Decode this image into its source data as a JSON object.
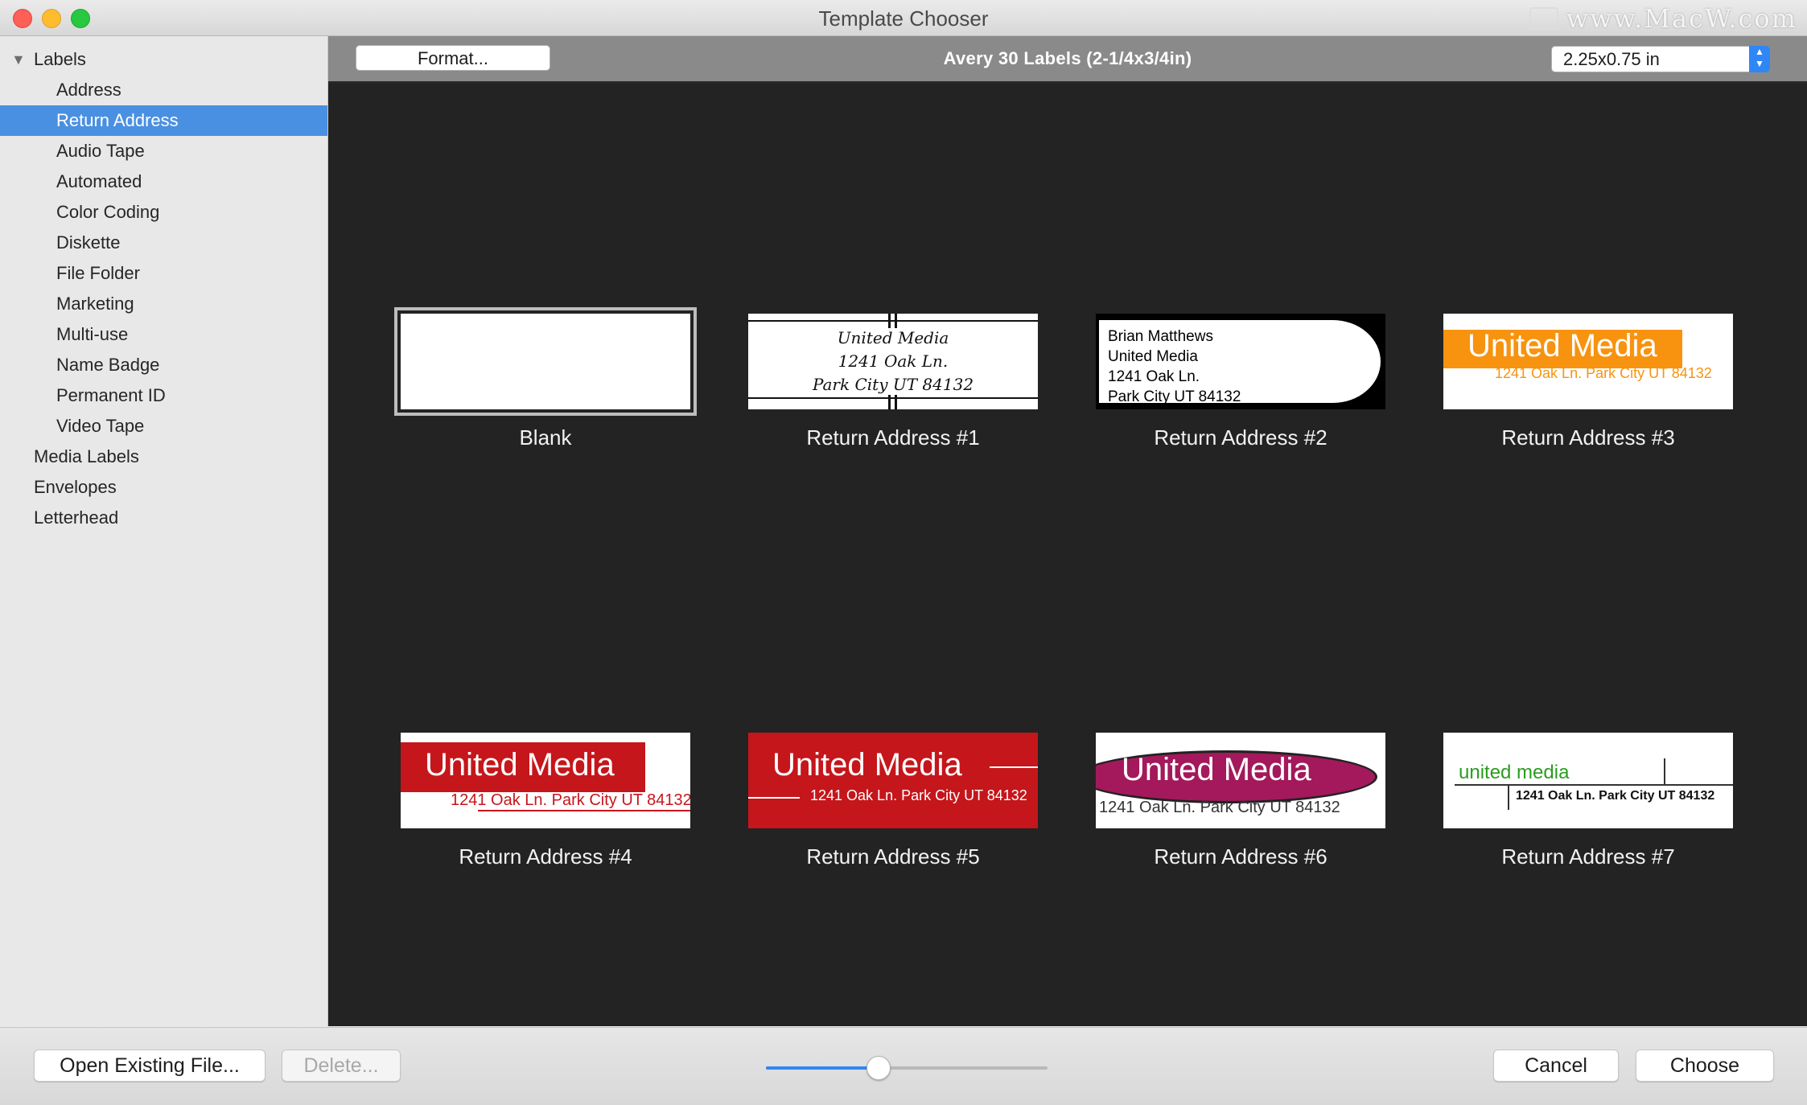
{
  "window": {
    "title": "Template Chooser",
    "watermark": "www.MacW.com"
  },
  "sidebar": {
    "items": [
      {
        "label": "Labels",
        "level": 0,
        "expanded": true
      },
      {
        "label": "Address",
        "level": 1
      },
      {
        "label": "Return Address",
        "level": 1,
        "selected": true
      },
      {
        "label": "Audio Tape",
        "level": 1
      },
      {
        "label": "Automated",
        "level": 1
      },
      {
        "label": "Color Coding",
        "level": 1
      },
      {
        "label": "Diskette",
        "level": 1
      },
      {
        "label": "File Folder",
        "level": 1
      },
      {
        "label": "Marketing",
        "level": 1
      },
      {
        "label": "Multi-use",
        "level": 1
      },
      {
        "label": "Name Badge",
        "level": 1
      },
      {
        "label": "Permanent ID",
        "level": 1
      },
      {
        "label": "Video Tape",
        "level": 1
      },
      {
        "label": "Media Labels",
        "level": 0
      },
      {
        "label": "Envelopes",
        "level": 0
      },
      {
        "label": "Letterhead",
        "level": 0
      }
    ],
    "selected_color": "#4a90e2"
  },
  "toolbar": {
    "format_label": "Format...",
    "title": "Avery 30 Labels (2-1/4x3/4in)",
    "size_value": "2.25x0.75 in"
  },
  "templates": [
    {
      "label": "Blank",
      "selected": true
    },
    {
      "label": "Return Address #1",
      "lines": [
        "United Media",
        "1241 Oak Ln.",
        "Park City UT 84132"
      ]
    },
    {
      "label": "Return Address #2",
      "lines": [
        "Brian Matthews",
        "United Media",
        "1241 Oak Ln.",
        "Park City UT 84132"
      ]
    },
    {
      "label": "Return Address #3",
      "title": "United Media",
      "sub": "1241 Oak Ln. Park City UT 84132",
      "accent": "#f7930f"
    },
    {
      "label": "Return Address #4",
      "title": "United Media",
      "sub": "1241 Oak Ln. Park City UT 84132",
      "accent": "#c5161b"
    },
    {
      "label": "Return Address #5",
      "title": "United Media",
      "sub": "1241 Oak Ln. Park City UT 84132",
      "accent": "#c5161b"
    },
    {
      "label": "Return Address #6",
      "title": "United Media",
      "sub": "1241 Oak Ln. Park City UT 84132",
      "accent": "#a3195b"
    },
    {
      "label": "Return Address #7",
      "title": "united media",
      "sub": "1241 Oak Ln. Park City UT 84132",
      "accent": "#2a9c1f"
    }
  ],
  "bottom": {
    "open_label": "Open Existing File...",
    "delete_label": "Delete...",
    "cancel_label": "Cancel",
    "choose_label": "Choose",
    "zoom_fraction": 0.4
  }
}
